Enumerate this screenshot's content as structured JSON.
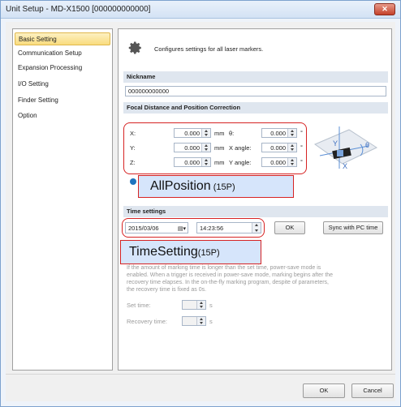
{
  "window": {
    "title": "Unit Setup - MD-X1500 [000000000000]",
    "close_label": "✕"
  },
  "sidebar": {
    "items": [
      {
        "label": "Basic Setting",
        "selected": true
      },
      {
        "label": "Communication Setup",
        "selected": false
      },
      {
        "label": "Expansion Processing",
        "selected": false
      },
      {
        "label": "I/O Setting",
        "selected": false
      },
      {
        "label": "Finder Setting",
        "selected": false
      },
      {
        "label": "Option",
        "selected": false
      }
    ]
  },
  "main": {
    "intro": "Configures settings for all laser markers.",
    "nickname": {
      "header": "Nickname",
      "value": "000000000000"
    },
    "focal": {
      "header": "Focal Distance and Position Correction",
      "x_label": "X:",
      "x_value": "0.000",
      "x_unit": "mm",
      "y_label": "Y:",
      "y_value": "0.000",
      "y_unit": "mm",
      "z_label": "Z:",
      "z_value": "0.000",
      "z_unit": "mm",
      "theta_label": "θ:",
      "theta_value": "0.000",
      "theta_unit": "°",
      "xangle_label": "X angle:",
      "xangle_value": "0.000",
      "xangle_unit": "°",
      "yangle_label": "Y angle:",
      "yangle_value": "0.000",
      "yangle_unit": "°",
      "diagram_y": "Y",
      "diagram_x": "X",
      "diagram_theta": "θ"
    },
    "time": {
      "header": "Time settings",
      "date": "2015/03/06",
      "time": "14:23:56",
      "ok_label": "OK",
      "sync_label": "Sync with PC time"
    },
    "power": {
      "description_lines": [
        "If the amount of marking time is longer than the set time, power-save mode is",
        "enabled. When a trigger is received in power-save mode, marking begins after the",
        "recovery time elapses. In the on-the-fly marking program, despite of parameters,",
        "the recovery time is fixed as 0s."
      ],
      "set_time_label": "Set time:",
      "set_time_unit": "s",
      "recovery_label": "Recovery time:",
      "recovery_unit": "s"
    }
  },
  "annotations": {
    "allposition_big": "AllPosition",
    "allposition_small": " (15P)",
    "timesetting_big": "TimeSetting",
    "timesetting_small": "(15P)"
  },
  "footer": {
    "ok_label": "OK",
    "cancel_label": "Cancel"
  },
  "colors": {
    "accent": "#d62323",
    "callout_bg": "#d6e5fb",
    "selected_bg": "#f9dc7e"
  }
}
